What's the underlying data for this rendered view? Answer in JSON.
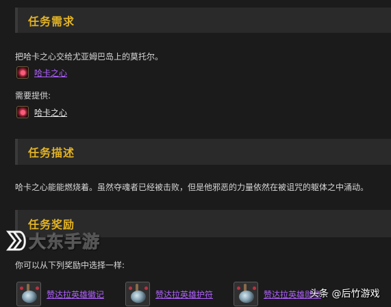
{
  "requirements": {
    "title": "任务需求",
    "objective": "把哈卡之心交给尤亚姆巴岛上的莫托尔。",
    "item_link": "哈卡之心",
    "provided_label": "需要提供:",
    "provided_item": "哈卡之心"
  },
  "description": {
    "title": "任务描述",
    "body": "哈卡之心能能燃烧着。虽然夺魂者已经被击败，但是他邪恶的力量依然在被诅咒的躯体之中涌动。"
  },
  "rewards": {
    "title": "任务奖励",
    "choose_text": "你可以从下列奖励中选择一样:",
    "items": [
      "赞达拉英雄徽记",
      "赞达拉英雄护符",
      "赞达拉英雄勋章"
    ]
  },
  "watermark": {
    "text": "大东手游",
    "credit": "头条 @后竹游戏"
  },
  "colors": {
    "header_title": "#e3b324",
    "item_link_purple": "#b060ff",
    "background": "#1b1b1b",
    "header_bg": "#2a2a2a"
  },
  "icons": [
    "heart-of-hakkar-icon",
    "amulet-icon",
    "watermark-logo-icon"
  ]
}
